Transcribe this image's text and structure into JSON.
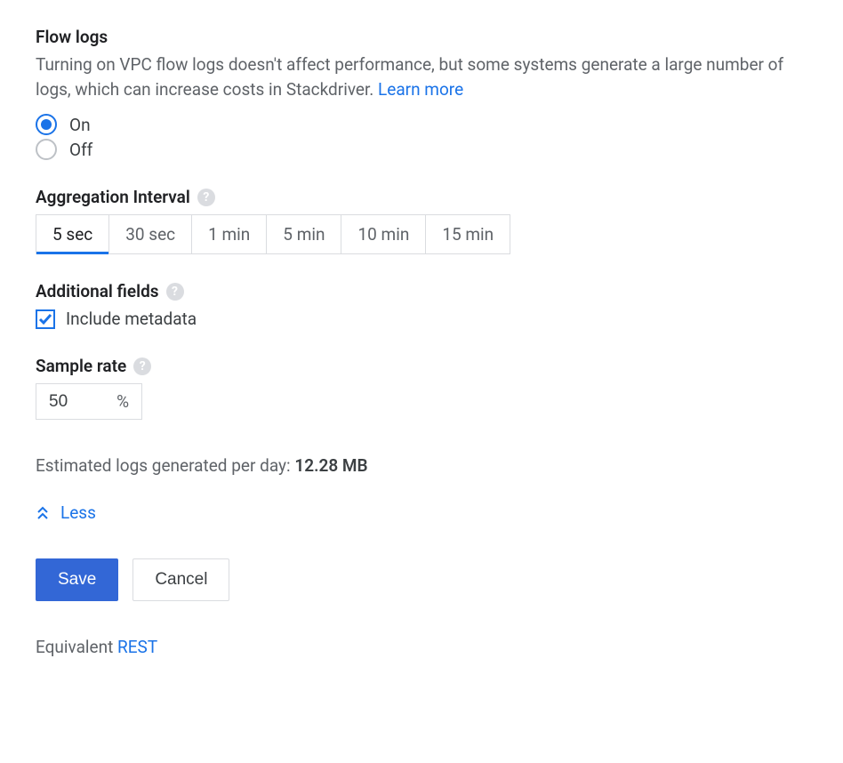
{
  "flowLogs": {
    "title": "Flow logs",
    "description": "Turning on VPC flow logs doesn't affect performance, but some systems generate a large number of logs, which can increase costs in Stackdriver. ",
    "learnMore": "Learn more",
    "radios": {
      "on": "On",
      "off": "Off",
      "selected": "on"
    }
  },
  "aggregation": {
    "label": "Aggregation Interval",
    "options": [
      "5 sec",
      "30 sec",
      "1 min",
      "5 min",
      "10 min",
      "15 min"
    ],
    "selected": "5 sec"
  },
  "additionalFields": {
    "label": "Additional fields",
    "checkboxLabel": "Include metadata",
    "checked": true
  },
  "sampleRate": {
    "label": "Sample rate",
    "value": "50",
    "unit": "%"
  },
  "estimate": {
    "prefix": "Estimated logs generated per day: ",
    "value": "12.28 MB"
  },
  "collapse": {
    "label": "Less"
  },
  "buttons": {
    "save": "Save",
    "cancel": "Cancel"
  },
  "equivalent": {
    "prefix": "Equivalent ",
    "link": "REST"
  },
  "help": "?"
}
